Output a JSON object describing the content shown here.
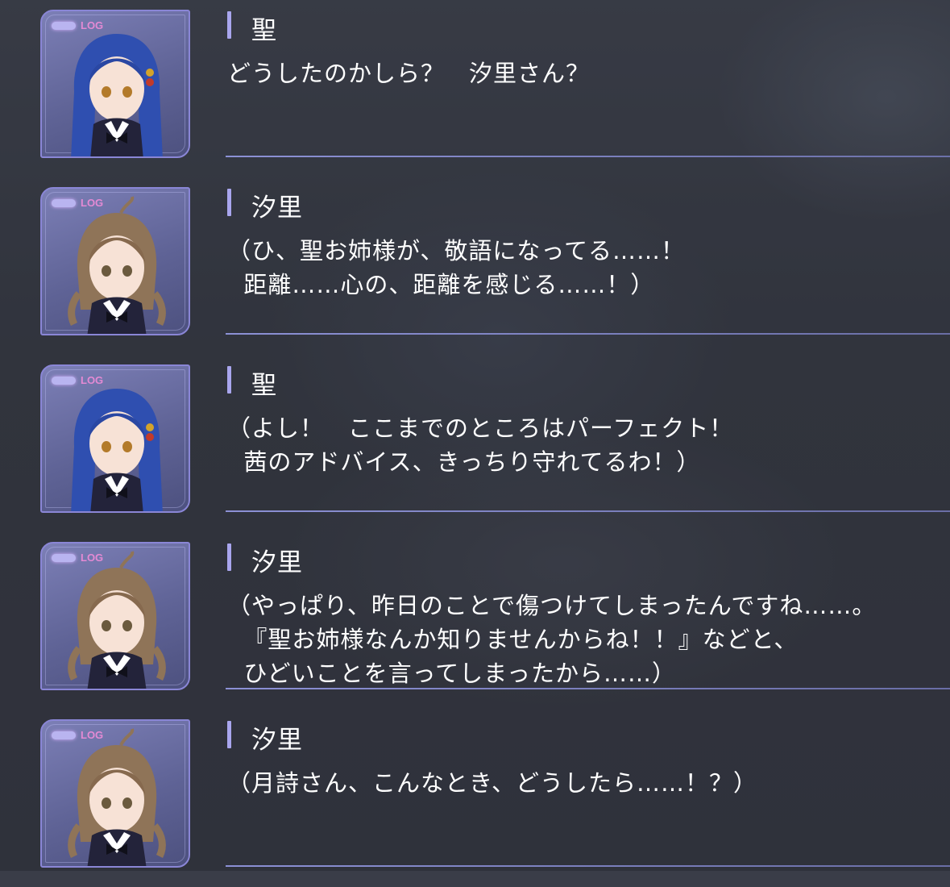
{
  "log": {
    "badge_label": "LOG",
    "entries": [
      {
        "speaker": "聖",
        "character": "blue-hair-girl",
        "lines": [
          "どうしたのかしら？　汐里さん？"
        ]
      },
      {
        "speaker": "汐里",
        "character": "brown-hair-girl",
        "lines": [
          "（ひ、聖お姉様が、敬語になってる……！",
          "  距離……心の、距離を感じる……！）"
        ]
      },
      {
        "speaker": "聖",
        "character": "blue-hair-girl",
        "lines": [
          "（よし！　ここまでのところはパーフェクト！",
          "  茜のアドバイス、きっちり守れてるわ！）"
        ]
      },
      {
        "speaker": "汐里",
        "character": "brown-hair-girl",
        "lines": [
          "（やっぱり、昨日のことで傷つけてしまったんですね……。",
          "  『聖お姉様なんか知りませんからね！！』などと、",
          "  ひどいことを言ってしまったから……）"
        ]
      },
      {
        "speaker": "汐里",
        "character": "brown-hair-girl",
        "lines": [
          "（月詩さん、こんなとき、どうしたら……！？）"
        ]
      }
    ]
  },
  "colors": {
    "accent": "#a9a6ee",
    "divider": "#9a9de6",
    "log_badge_text": "#e48ad4",
    "blue_hair": "#2f4fb0",
    "brown_hair": "#8f7458",
    "uniform": "#23233a"
  }
}
